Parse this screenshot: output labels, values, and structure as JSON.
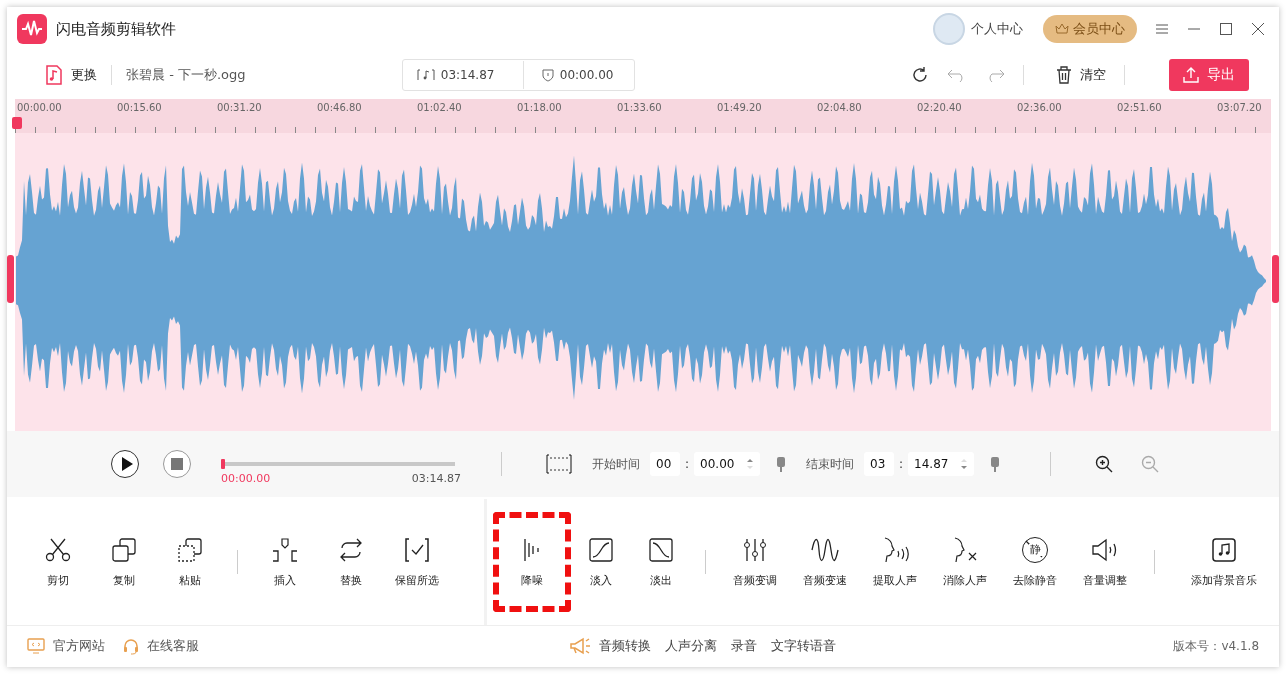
{
  "app": {
    "title": "闪电音频剪辑软件",
    "user_center": "个人中心",
    "vip": "会员中心"
  },
  "toolbar": {
    "replace": "更换",
    "filename": "张碧晨 - 下一秒.ogg",
    "duration": "03:14.87",
    "selection": "00:00.00",
    "clear": "清空",
    "export": "导出"
  },
  "ruler": [
    "00:00.00",
    "00:15.60",
    "00:31.20",
    "00:46.80",
    "01:02.40",
    "01:18.00",
    "01:33.60",
    "01:49.20",
    "02:04.80",
    "02:20.40",
    "02:36.00",
    "02:51.60",
    "03:07.20"
  ],
  "playback": {
    "position": "00:00.00",
    "total": "03:14.87",
    "level": 0
  },
  "range": {
    "start_label": "开始时间",
    "start_min": "00",
    "start_sec": "00.00",
    "end_label": "结束时间",
    "end_min": "03",
    "end_sec": "14.87",
    "separator": ":"
  },
  "panels": [
    {
      "groups": [
        [
          {
            "kind": "cut",
            "label": "剪切",
            "highlighted": false
          },
          {
            "kind": "copy",
            "label": "复制",
            "highlighted": false
          },
          {
            "kind": "paste",
            "label": "粘贴",
            "highlighted": false
          }
        ],
        [
          {
            "kind": "insert",
            "label": "插入",
            "highlighted": false
          },
          {
            "kind": "replace",
            "label": "替换",
            "highlighted": false
          },
          {
            "kind": "keep",
            "label": "保留所选",
            "highlighted": false
          }
        ]
      ]
    },
    {
      "groups": [
        [
          {
            "kind": "denoise",
            "label": "降噪",
            "highlighted": true
          },
          {
            "kind": "fadein",
            "label": "淡入",
            "highlighted": false
          },
          {
            "kind": "fadeout",
            "label": "淡出",
            "highlighted": false
          }
        ],
        [
          {
            "kind": "pitch",
            "label": "音频变调",
            "highlighted": false
          },
          {
            "kind": "speed",
            "label": "音频变速",
            "highlighted": false
          },
          {
            "kind": "extract",
            "label": "提取人声",
            "highlighted": false
          },
          {
            "kind": "remove",
            "label": "消除人声",
            "highlighted": false
          },
          {
            "kind": "silence",
            "label": "去除静音",
            "highlighted": false,
            "glyph": "静"
          },
          {
            "kind": "volume",
            "label": "音量调整",
            "highlighted": false
          }
        ],
        [
          {
            "kind": "bgm",
            "label": "添加背景音乐",
            "highlighted": false
          }
        ]
      ]
    }
  ],
  "footer": {
    "left": [
      {
        "kind": "website",
        "label": "官方网站"
      },
      {
        "kind": "service",
        "label": "在线客服"
      }
    ],
    "center": [
      {
        "kind": "convert",
        "label": "音频转换"
      },
      {
        "kind": "plain",
        "label": "人声分离"
      },
      {
        "kind": "plain",
        "label": "录音"
      },
      {
        "kind": "plain",
        "label": "文字转语音"
      }
    ],
    "version": "版本号：v4.1.8"
  }
}
